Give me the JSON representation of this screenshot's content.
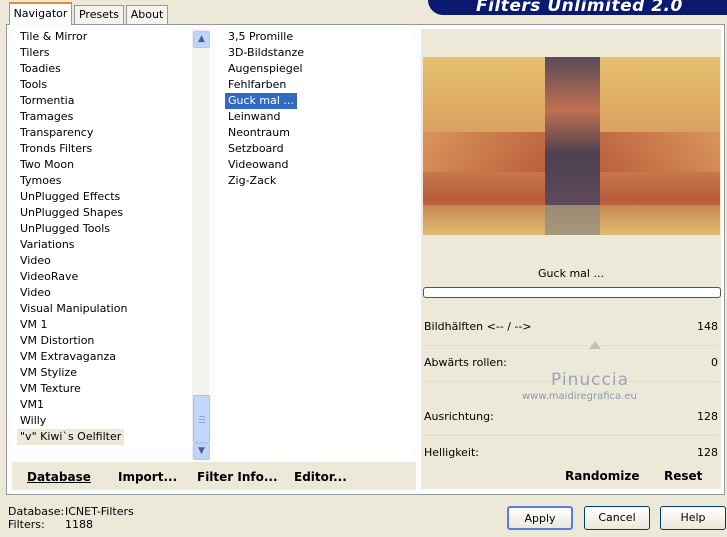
{
  "banner": "Filters Unlimited 2.0",
  "tabs": [
    "Navigator",
    "Presets",
    "About"
  ],
  "categories": [
    "Tile & Mirror",
    "Tilers",
    "Toadies",
    "Tools",
    "Tormentia",
    "Tramages",
    "Transparency",
    "Tronds Filters",
    "Two Moon",
    "Tymoes",
    "UnPlugged Effects",
    "UnPlugged Shapes",
    "UnPlugged Tools",
    "Variations",
    "Video",
    "VideoRave",
    "Video",
    "Visual Manipulation",
    "VM 1",
    "VM Distortion",
    "VM Extravaganza",
    "VM Stylize",
    "VM Texture",
    "VM1",
    "Willy",
    "\"v\" Kiwi`s Oelfilter"
  ],
  "filters": [
    "3,5 Promille",
    "3D-Bildstanze",
    "Augenspiegel",
    "Fehlfarben",
    "Guck mal ...",
    "Leinwand",
    "Neontraum",
    "Setzboard",
    "Videowand",
    "Zig-Zack"
  ],
  "selected_filter_name": "Guck mal ...",
  "bottom_buttons": {
    "database": "Database",
    "import": "Import...",
    "filter_info": "Filter Info...",
    "editor": "Editor..."
  },
  "params": [
    {
      "label": "Bildhälften <-- / -->",
      "value": "148"
    },
    {
      "label": "Abwärts rollen:",
      "value": "0"
    },
    {
      "label": "Ausrichtung:",
      "value": "128"
    },
    {
      "label": "Helligkeit:",
      "value": "128"
    }
  ],
  "right_buttons": {
    "randomize": "Randomize",
    "reset": "Reset"
  },
  "watermark": {
    "name": "Pinuccia",
    "url": "www.maidiregrafica.eu"
  },
  "status": {
    "database_label": "Database:",
    "database_value": "ICNET-Filters",
    "filters_label": "Filters:",
    "filters_value": "1188"
  },
  "dialog_buttons": {
    "apply": "Apply",
    "cancel": "Cancel",
    "help": "Help"
  },
  "colors": {
    "selection": "#316ac5",
    "banner": "#0b1a6e",
    "tab_accent": "#e68b2c"
  }
}
